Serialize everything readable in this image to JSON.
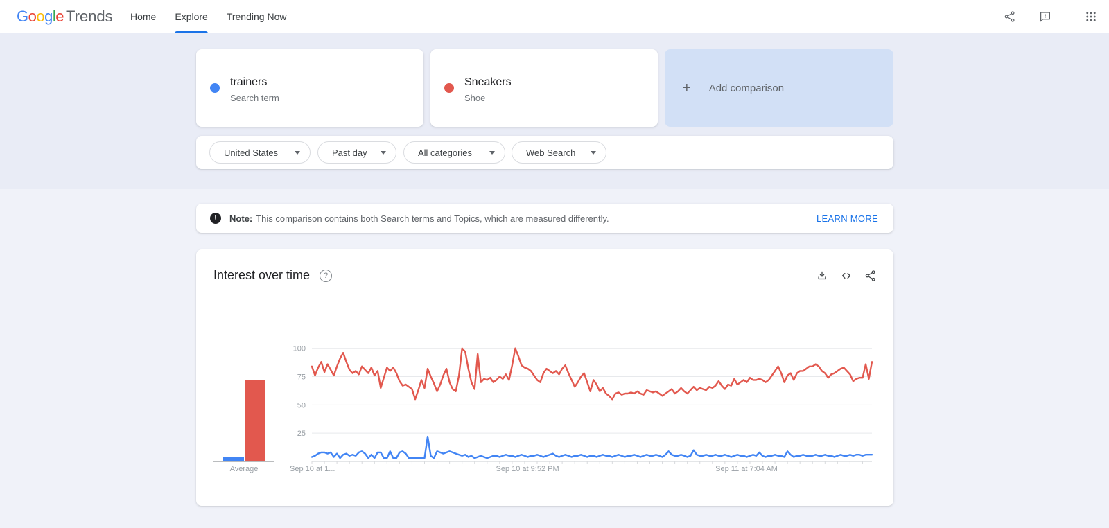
{
  "header": {
    "logo": {
      "brand_letters": [
        "G",
        "o",
        "o",
        "g",
        "l",
        "e"
      ],
      "brand_colors": [
        "#4285F4",
        "#EA4335",
        "#FBBC05",
        "#4285F4",
        "#34A853",
        "#EA4335"
      ],
      "product": "Trends"
    },
    "nav": [
      {
        "label": "Home",
        "active": false
      },
      {
        "label": "Explore",
        "active": true
      },
      {
        "label": "Trending Now",
        "active": false
      }
    ],
    "icons": [
      "share-icon",
      "feedback-icon",
      "apps-grid-icon"
    ],
    "accent_color": "#1a73e8"
  },
  "comparison": {
    "terms": [
      {
        "name": "trainers",
        "type": "Search term",
        "color": "#4285f4"
      },
      {
        "name": "Sneakers",
        "type": "Shoe",
        "color": "#e2584e"
      }
    ],
    "add_icon_glyph": "+",
    "add_label": "Add comparison"
  },
  "filters": [
    {
      "label": "United States"
    },
    {
      "label": "Past day"
    },
    {
      "label": "All categories"
    },
    {
      "label": "Web Search"
    }
  ],
  "note": {
    "icon_glyph": "!",
    "prefix": "Note:",
    "text": "This comparison contains both Search terms and Topics, which are measured differently.",
    "link": "LEARN MORE"
  },
  "chart_panel": {
    "title": "Interest over time",
    "help_glyph": "?",
    "toolbar_icons": [
      "download-icon",
      "embed-code-icon",
      "share-icon"
    ]
  },
  "chart_data": {
    "type": "line",
    "title": "Interest over time",
    "average_label": "Average",
    "grid": true,
    "legend_position": "none",
    "y_axis": {
      "ticks": [
        25,
        50,
        75,
        100
      ],
      "range": [
        0,
        100
      ]
    },
    "x_axis": {
      "tick_labels": [
        "Sep 10 at 1...",
        "Sep 10 at 9:52 PM",
        "Sep 11 at 7:04 AM"
      ],
      "positions": [
        0,
        0.385,
        0.776
      ]
    },
    "series": [
      {
        "name": "trainers",
        "color": "#4285f4",
        "average": 4,
        "values": [
          4,
          5,
          7,
          8,
          8,
          7,
          8,
          4,
          7,
          3,
          6,
          7,
          5,
          6,
          5,
          8,
          9,
          7,
          3,
          6,
          3,
          8,
          8,
          3,
          3,
          9,
          3,
          3,
          8,
          9,
          7,
          3,
          3,
          3,
          3,
          3,
          3,
          22,
          5,
          3,
          9,
          8,
          7,
          8,
          9,
          8,
          7,
          6,
          5,
          6,
          4,
          5,
          3,
          4,
          5,
          4,
          3,
          4,
          5,
          5,
          4,
          5,
          6,
          5,
          5,
          4,
          5,
          6,
          5,
          4,
          5,
          5,
          6,
          5,
          4,
          5,
          6,
          7,
          5,
          4,
          5,
          6,
          5,
          4,
          5,
          5,
          6,
          5,
          4,
          5,
          5,
          4,
          5,
          6,
          5,
          5,
          4,
          5,
          6,
          5,
          4,
          5,
          5,
          6,
          5,
          4,
          5,
          6,
          5,
          5,
          6,
          5,
          4,
          6,
          9,
          6,
          5,
          5,
          6,
          5,
          4,
          5,
          10,
          6,
          5,
          5,
          6,
          5,
          5,
          6,
          5,
          5,
          6,
          5,
          4,
          5,
          6,
          5,
          5,
          4,
          5,
          6,
          5,
          8,
          5,
          4,
          5,
          5,
          6,
          5,
          5,
          4,
          9,
          6,
          4,
          5,
          5,
          6,
          5,
          5,
          5,
          6,
          5,
          5,
          6,
          5,
          5,
          4,
          5,
          6,
          5,
          5,
          6,
          5,
          6,
          6,
          5,
          6,
          6,
          6
        ]
      },
      {
        "name": "Sneakers",
        "color": "#e2584e",
        "average": 72,
        "values": [
          84,
          76,
          83,
          88,
          79,
          86,
          81,
          76,
          84,
          91,
          96,
          88,
          81,
          78,
          80,
          77,
          84,
          81,
          78,
          83,
          76,
          80,
          65,
          74,
          83,
          80,
          83,
          78,
          71,
          67,
          68,
          66,
          64,
          55,
          63,
          72,
          65,
          82,
          75,
          69,
          62,
          68,
          76,
          82,
          70,
          64,
          62,
          76,
          100,
          97,
          82,
          70,
          64,
          95,
          70,
          73,
          72,
          74,
          70,
          72,
          75,
          73,
          77,
          72,
          85,
          100,
          93,
          85,
          83,
          82,
          80,
          76,
          72,
          70,
          78,
          82,
          80,
          78,
          80,
          77,
          82,
          85,
          78,
          72,
          66,
          70,
          75,
          78,
          70,
          62,
          72,
          68,
          62,
          65,
          60,
          58,
          55,
          60,
          61,
          59,
          60,
          60,
          61,
          60,
          62,
          60,
          59,
          63,
          62,
          61,
          62,
          60,
          58,
          60,
          62,
          64,
          60,
          62,
          65,
          62,
          60,
          63,
          66,
          63,
          65,
          64,
          63,
          66,
          65,
          67,
          71,
          67,
          64,
          68,
          67,
          73,
          68,
          70,
          72,
          70,
          74,
          72,
          72,
          73,
          72,
          70,
          72,
          76,
          80,
          84,
          78,
          70,
          76,
          78,
          72,
          78,
          80,
          80,
          82,
          84,
          84,
          86,
          84,
          80,
          78,
          74,
          77,
          78,
          80,
          82,
          83,
          80,
          77,
          71,
          73,
          74,
          74,
          86,
          73,
          88
        ]
      }
    ]
  }
}
